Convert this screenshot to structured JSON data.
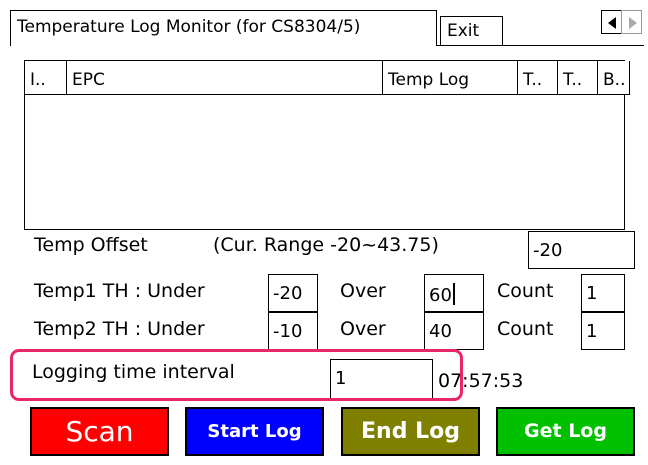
{
  "tabs": [
    {
      "label": "Temperature Log Monitor (for CS8304/5)"
    },
    {
      "label": "Exit"
    }
  ],
  "list": {
    "columns": [
      "I..",
      "EPC",
      "Temp Log",
      "T..",
      "T..",
      "B.."
    ]
  },
  "offset": {
    "label": "Temp Offset",
    "range": "(Cur. Range -20~43.75)",
    "value": "-20"
  },
  "temp1": {
    "label": "Temp1 TH : Under",
    "under": "-20",
    "over_label": "Over",
    "over": "60",
    "count_label": "Count",
    "count": "1"
  },
  "temp2": {
    "label": "Temp2 TH : Under",
    "under": "-10",
    "over_label": "Over",
    "over": "40",
    "count_label": "Count",
    "count": "1"
  },
  "logging": {
    "label": "Logging time interval",
    "value": "1",
    "time": "07:57:53"
  },
  "buttons": {
    "scan": "Scan",
    "start_log": "Start Log",
    "end_log": "End Log",
    "get_log": "Get Log"
  },
  "colors": {
    "scan": "#ff0000",
    "start_log": "#0000ff",
    "end_log": "#808000",
    "get_log": "#00c000",
    "highlight": "#e8266a"
  }
}
